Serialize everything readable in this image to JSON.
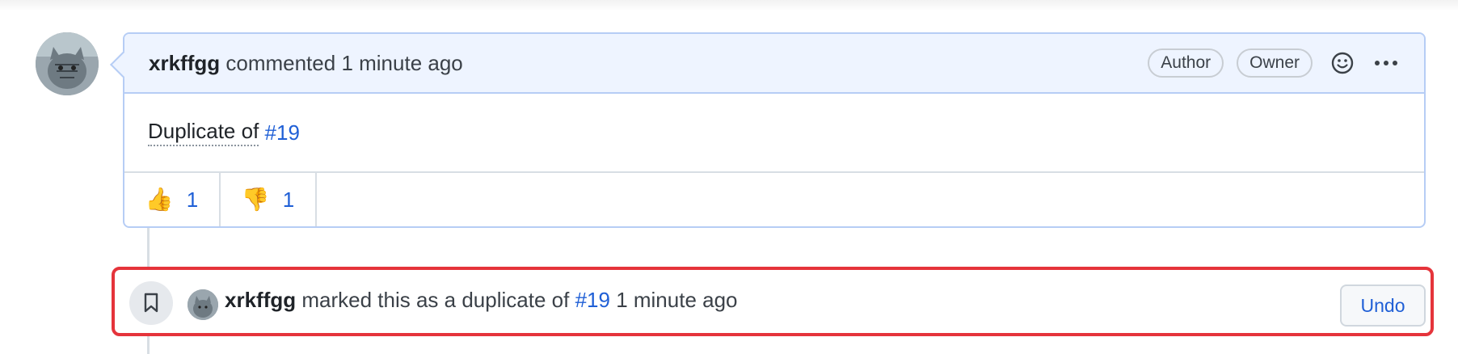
{
  "comment": {
    "author": "xrkffgg",
    "action": "commented",
    "time": "1 minute ago",
    "badges": [
      "Author",
      "Owner"
    ],
    "body_text": "Duplicate of",
    "body_link": "#19",
    "reactions": [
      {
        "emoji": "👍",
        "icon": "thumbs-up",
        "count": "1"
      },
      {
        "emoji": "👎",
        "icon": "thumbs-down",
        "count": "1"
      }
    ]
  },
  "event": {
    "author": "xrkffgg",
    "text": "marked this as a duplicate of",
    "link": "#19",
    "time": "1 minute ago",
    "undo_label": "Undo",
    "icon": "bookmark-icon"
  },
  "colors": {
    "link": "#1f5fd6",
    "header_bg": "#eef4ff",
    "highlight_border": "#e5343b"
  }
}
